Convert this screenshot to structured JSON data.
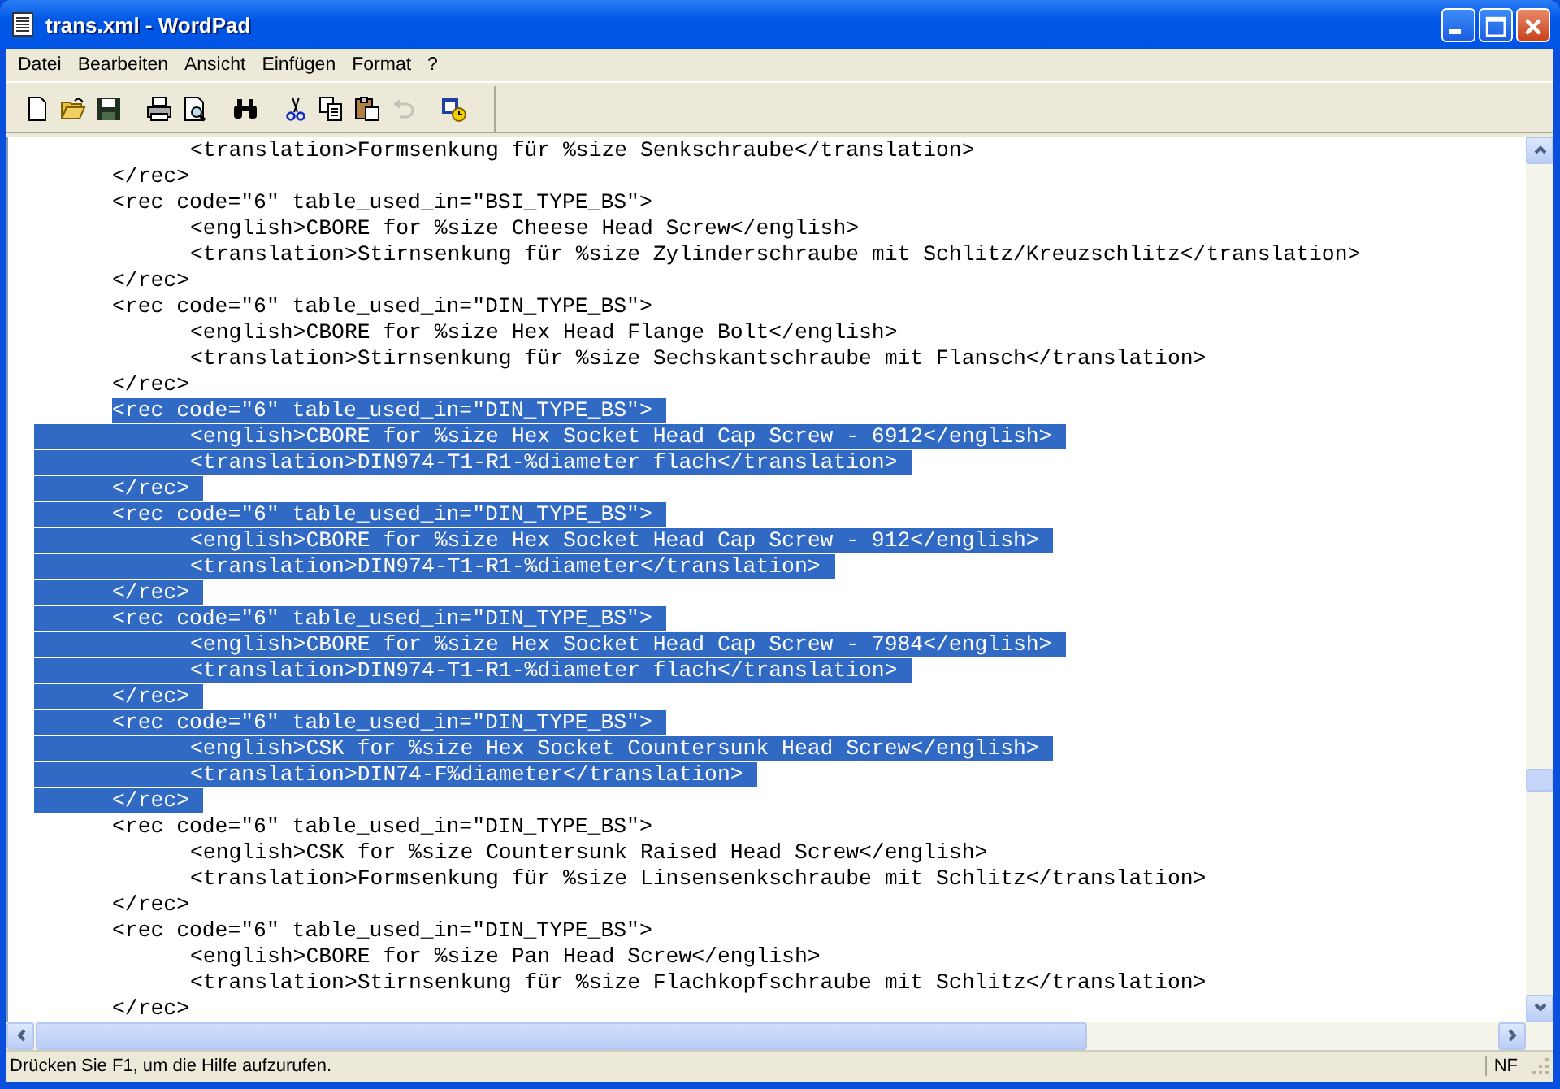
{
  "window": {
    "title": "trans.xml - WordPad"
  },
  "menu": [
    "Datei",
    "Bearbeiten",
    "Ansicht",
    "Einfügen",
    "Format",
    "?"
  ],
  "toolbar": [
    {
      "kind": "new",
      "disabled": false
    },
    {
      "kind": "open",
      "disabled": false
    },
    {
      "kind": "save",
      "disabled": false
    },
    {
      "kind": "sep"
    },
    {
      "kind": "print",
      "disabled": false
    },
    {
      "kind": "preview",
      "disabled": false
    },
    {
      "kind": "sep"
    },
    {
      "kind": "find",
      "disabled": false
    },
    {
      "kind": "sep"
    },
    {
      "kind": "cut",
      "disabled": false
    },
    {
      "kind": "copy",
      "disabled": false
    },
    {
      "kind": "paste",
      "disabled": false
    },
    {
      "kind": "undo",
      "disabled": true
    },
    {
      "kind": "sep"
    },
    {
      "kind": "datetime",
      "disabled": false
    }
  ],
  "document": {
    "lines": [
      {
        "text": "\t\t<translation>Formsenkung für %size Senkschraube</translation>",
        "selected": false
      },
      {
        "text": "\t</rec>",
        "selected": false
      },
      {
        "text": "\t<rec code=\"6\" table_used_in=\"BSI_TYPE_BS\">",
        "selected": false
      },
      {
        "text": "\t\t<english>CBORE for %size Cheese Head Screw</english>",
        "selected": false
      },
      {
        "text": "\t\t<translation>Stirnsenkung für %size Zylinderschraube mit Schlitz/Kreuzschlitz</translation>",
        "selected": false
      },
      {
        "text": "\t</rec>",
        "selected": false
      },
      {
        "text": "\t<rec code=\"6\" table_used_in=\"DIN_TYPE_BS\">",
        "selected": false
      },
      {
        "text": "\t\t<english>CBORE for %size Hex Head Flange Bolt</english>",
        "selected": false
      },
      {
        "text": "\t\t<translation>Stirnsenkung für %size Sechskantschraube mit Flansch</translation>",
        "selected": false
      },
      {
        "text": "\t</rec>",
        "selected": false
      },
      {
        "text": "\t<rec code=\"6\" table_used_in=\"DIN_TYPE_BS\">",
        "selected": true
      },
      {
        "text": "\t\t<english>CBORE for %size Hex Socket Head Cap Screw - 6912</english>",
        "selected": true
      },
      {
        "text": "\t\t<translation>DIN974-T1-R1-%diameter flach</translation>",
        "selected": true
      },
      {
        "text": "\t</rec>",
        "selected": true
      },
      {
        "text": "\t<rec code=\"6\" table_used_in=\"DIN_TYPE_BS\">",
        "selected": true
      },
      {
        "text": "\t\t<english>CBORE for %size Hex Socket Head Cap Screw - 912</english>",
        "selected": true
      },
      {
        "text": "\t\t<translation>DIN974-T1-R1-%diameter</translation>",
        "selected": true
      },
      {
        "text": "\t</rec>",
        "selected": true
      },
      {
        "text": "\t<rec code=\"6\" table_used_in=\"DIN_TYPE_BS\">",
        "selected": true
      },
      {
        "text": "\t\t<english>CBORE for %size Hex Socket Head Cap Screw - 7984</english>",
        "selected": true
      },
      {
        "text": "\t\t<translation>DIN974-T1-R1-%diameter flach</translation>",
        "selected": true
      },
      {
        "text": "\t</rec>",
        "selected": true
      },
      {
        "text": "\t<rec code=\"6\" table_used_in=\"DIN_TYPE_BS\">",
        "selected": true
      },
      {
        "text": "\t\t<english>CSK for %size Hex Socket Countersunk Head Screw</english>",
        "selected": true
      },
      {
        "text": "\t\t<translation>DIN74-F%diameter</translation>",
        "selected": true
      },
      {
        "text": "\t</rec>",
        "selected": true
      },
      {
        "text": "\t<rec code=\"6\" table_used_in=\"DIN_TYPE_BS\">",
        "selected": false
      },
      {
        "text": "\t\t<english>CSK for %size Countersunk Raised Head Screw</english>",
        "selected": false
      },
      {
        "text": "\t\t<translation>Formsenkung für %size Linsensenkschraube mit Schlitz</translation>",
        "selected": false
      },
      {
        "text": "\t</rec>",
        "selected": false
      },
      {
        "text": "\t<rec code=\"6\" table_used_in=\"DIN_TYPE_BS\">",
        "selected": false
      },
      {
        "text": "\t\t<english>CBORE for %size Pan Head Screw</english>",
        "selected": false
      },
      {
        "text": "\t\t<translation>Stirnsenkung für %size Flachkopfschraube mit Schlitz</translation>",
        "selected": false
      },
      {
        "text": "\t</rec>",
        "selected": false
      }
    ]
  },
  "status_bar": {
    "message": "Drücken Sie F1, um die Hilfe aufzurufen.",
    "indicator": "NF"
  }
}
